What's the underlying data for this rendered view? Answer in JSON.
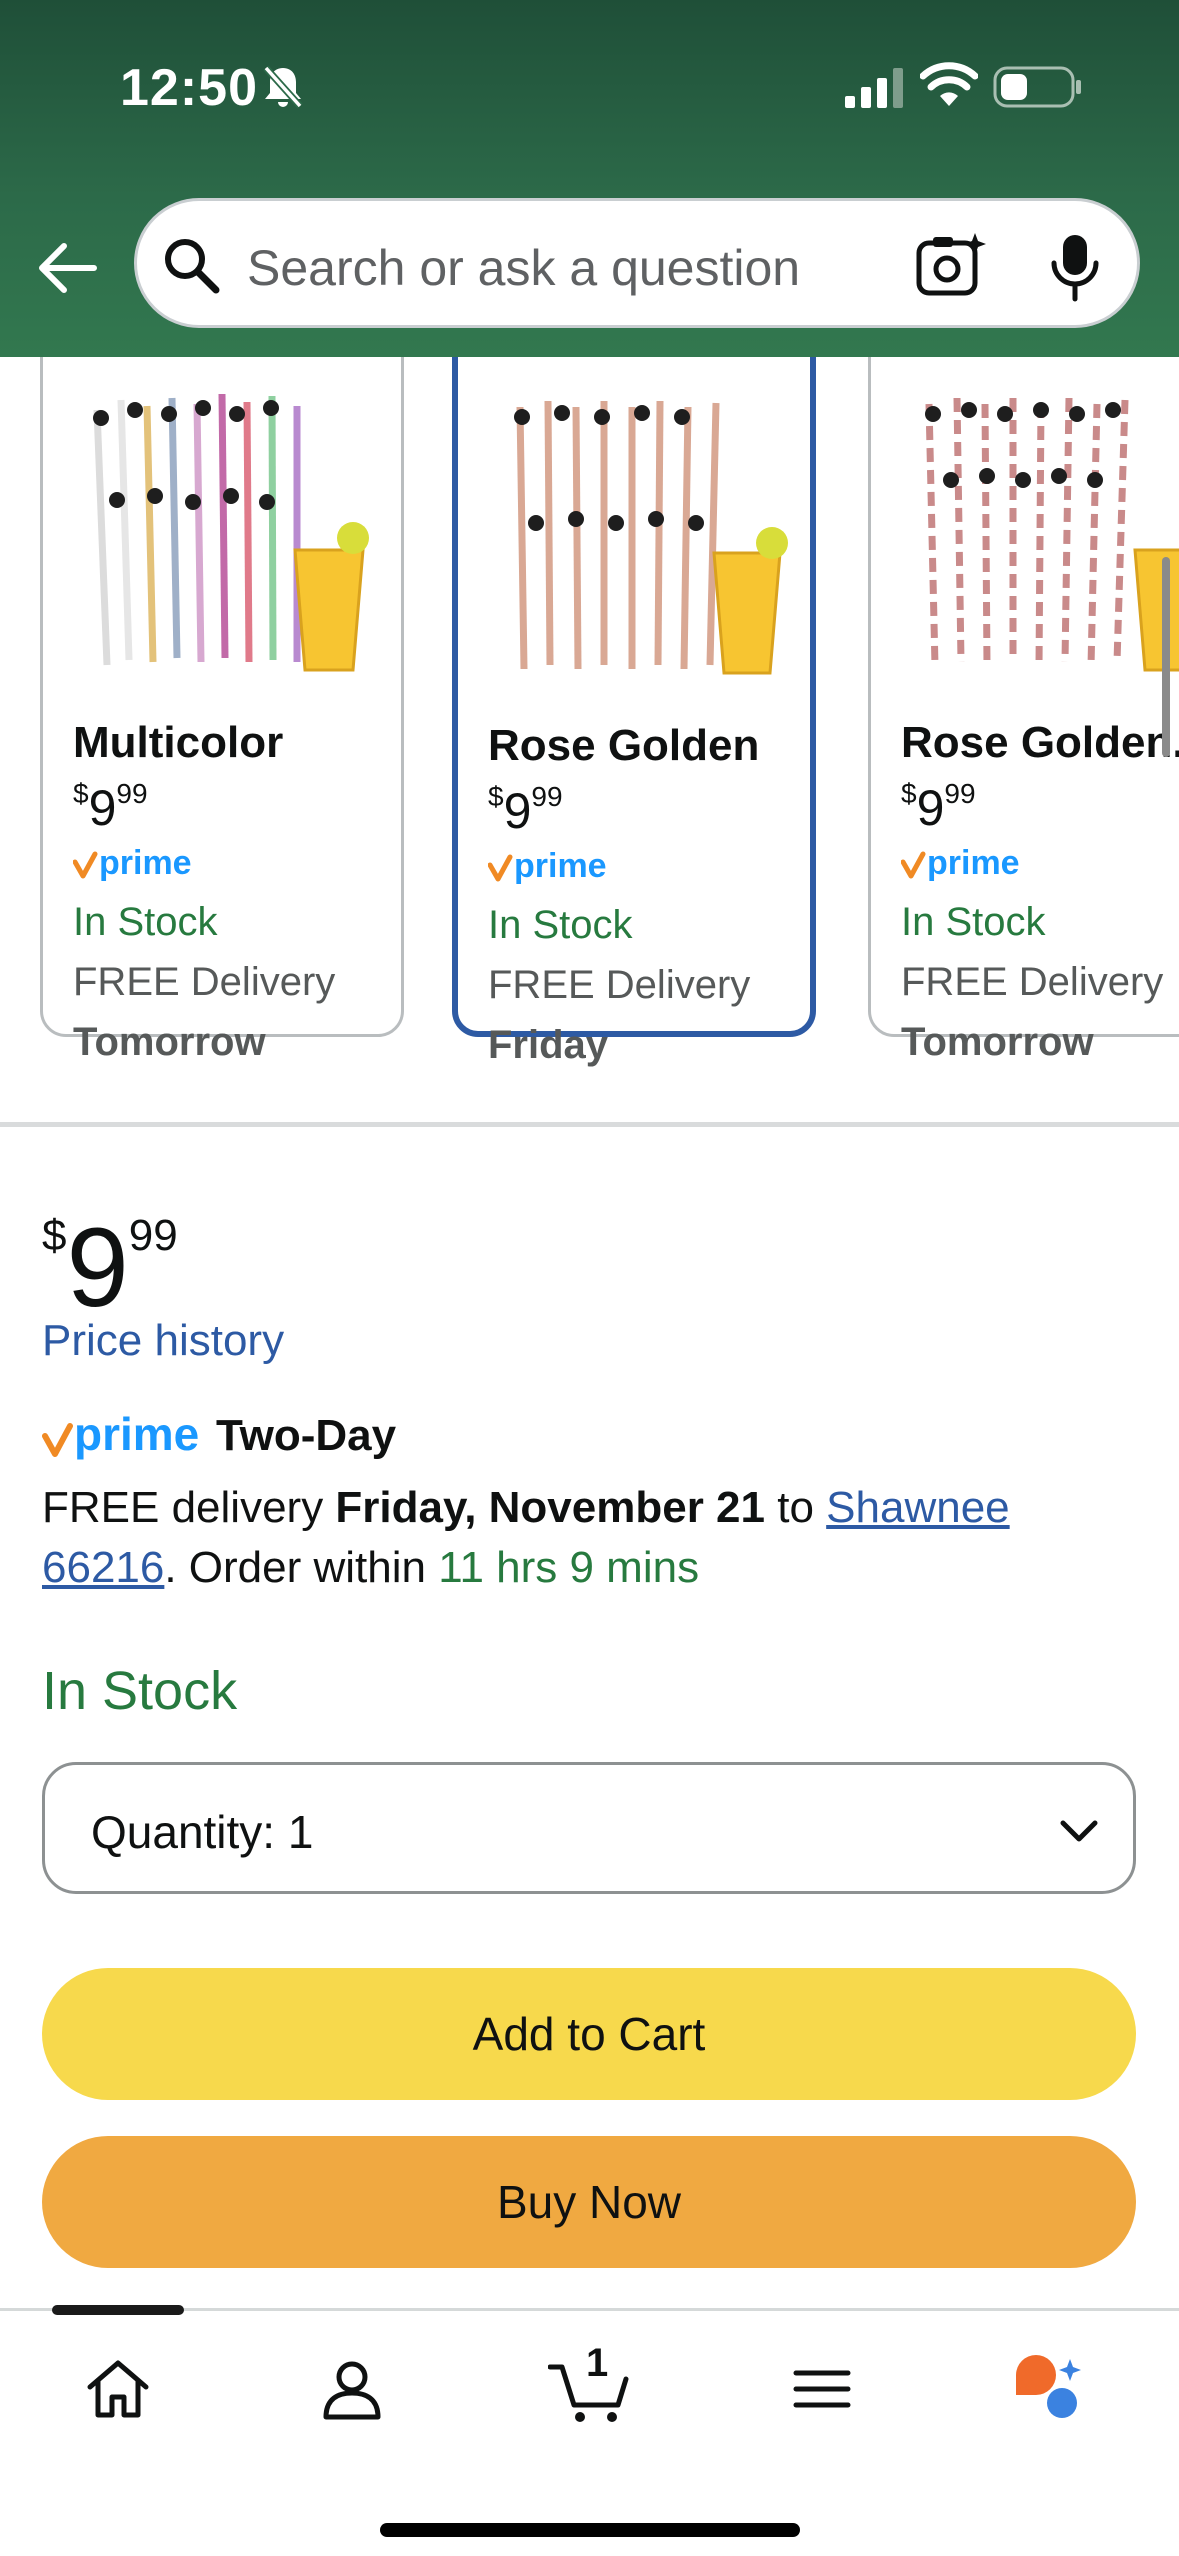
{
  "status_bar": {
    "time": "12:50"
  },
  "search": {
    "placeholder": "Search or ask a question"
  },
  "variants": [
    {
      "name": "Multicolor",
      "price_symbol": "$",
      "price_whole": "9",
      "price_cents": "99",
      "prime": "prime",
      "stock": "In Stock",
      "delivery": "FREE Delivery",
      "when": "Tomorrow",
      "selected": false
    },
    {
      "name": "Rose Golden",
      "price_symbol": "$",
      "price_whole": "9",
      "price_cents": "99",
      "prime": "prime",
      "stock": "In Stock",
      "delivery": "FREE Delivery",
      "when": "Friday",
      "selected": true
    },
    {
      "name": "Rose Golden...",
      "price_symbol": "$",
      "price_whole": "9",
      "price_cents": "99",
      "prime": "prime",
      "stock": "In Stock",
      "delivery": "FREE Delivery",
      "when": "Tomorrow",
      "selected": false
    }
  ],
  "buybox": {
    "price_symbol": "$",
    "price_whole": "9",
    "price_cents": "99",
    "price_history": "Price history",
    "prime_label": "prime",
    "prime_speed": "Two-Day",
    "delivery_prefix": "FREE delivery ",
    "delivery_date": "Friday, November 21",
    "delivery_to": " to ",
    "location_line1": "Shawnee",
    "location_line2": "66216",
    "order_within_prefix": ". Order within ",
    "order_within_time": "11 hrs 9 mins",
    "stock": "In Stock",
    "quantity_label": "Quantity:",
    "quantity_value": "1",
    "add_to_cart": "Add to Cart",
    "buy_now": "Buy Now"
  },
  "bottom_nav": {
    "cart_count": "1",
    "items": [
      "home-icon",
      "account-icon",
      "cart-icon",
      "menu-icon",
      "rufus-ai-icon"
    ]
  },
  "colors": {
    "header_green": "#2c6a49",
    "link_blue": "#2d5aa4",
    "stock_green": "#277a3f",
    "cart_yellow": "#f7d94c",
    "buy_orange": "#f0a941",
    "prime_blue": "#1a98ff",
    "prime_check_orange": "#f08a24"
  }
}
